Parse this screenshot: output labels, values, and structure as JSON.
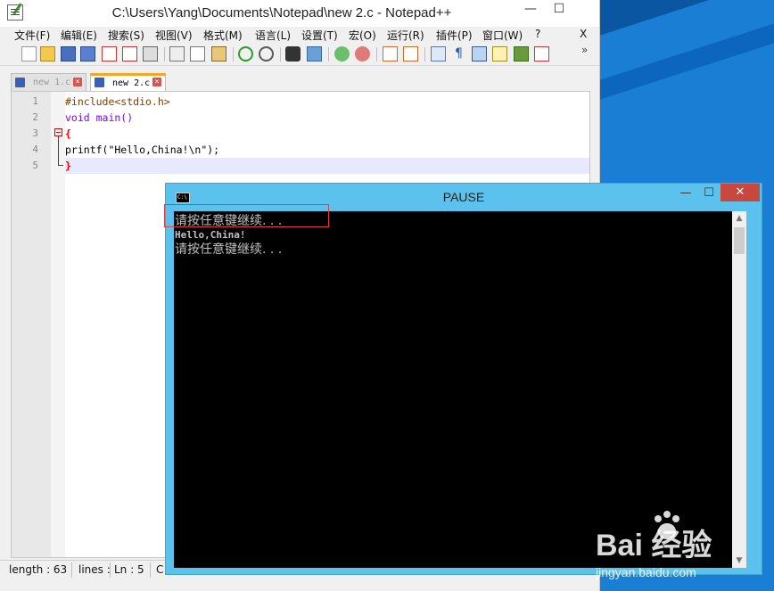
{
  "notepad": {
    "title": "C:\\Users\\Yang\\Documents\\Notepad\\new  2.c - Notepad++",
    "minimize": "—",
    "maximize": "☐",
    "close_menu": "X",
    "menu": [
      "文件(F)",
      "编辑(E)",
      "搜索(S)",
      "视图(V)",
      "格式(M)",
      "语言(L)",
      "设置(T)",
      "宏(O)",
      "运行(R)",
      "插件(P)",
      "窗口(W)",
      "?"
    ],
    "toolbar_overflow": "»",
    "tabs": [
      {
        "label": "new  1.c",
        "active": false
      },
      {
        "label": "new  2.c",
        "active": true
      }
    ],
    "code_lines": [
      {
        "num": "1",
        "text": "#include<stdio.h>"
      },
      {
        "num": "2",
        "text": "void main()"
      },
      {
        "num": "3",
        "text": "{"
      },
      {
        "num": "4",
        "text": "printf(\"Hello,China!\\n\");"
      },
      {
        "num": "5",
        "text": "}"
      }
    ],
    "status": {
      "length": "length : 63",
      "lines": "lines :",
      "ln": "Ln : 5",
      "col": "C"
    }
  },
  "console": {
    "title": "PAUSE",
    "icon_text": "C:\\",
    "lines": [
      "请按任意键继续. . .",
      "Hello,China!",
      "请按任意键继续. . ."
    ],
    "close": "✕",
    "min": "—",
    "max": "☐"
  },
  "watermark": {
    "brand": "Bai 经验",
    "url": "jingyan.baidu.com"
  },
  "colors": {
    "desktop": "#1a7fd4",
    "console_frame": "#5ac2ec",
    "highlight": "#e53c3c",
    "active_tab": "#f5a623"
  }
}
